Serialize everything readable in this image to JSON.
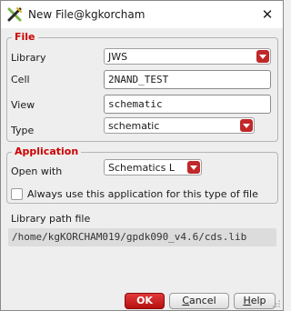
{
  "window": {
    "title": "New File@kgkorcham",
    "app_icon": "cadence-x-icon",
    "close_icon": "close-icon"
  },
  "file_group": {
    "legend": "File",
    "library_label": "Library",
    "library_value": "JWS",
    "cell_label": "Cell",
    "cell_value": "2NAND_TEST",
    "view_label": "View",
    "view_value": "schematic",
    "type_label": "Type",
    "type_value": "schematic"
  },
  "application_group": {
    "legend": "Application",
    "open_with_label": "Open with",
    "open_with_value": "Schematics L",
    "always_use_label": "Always use this application for this type of file",
    "always_use_checked": false
  },
  "library_path": {
    "label": "Library path file",
    "value": "/home/kgKORCHAM019/gpdk090_v4.6/cds.lib"
  },
  "buttons": {
    "ok": "OK",
    "cancel_first": "C",
    "cancel_rest": "ancel",
    "help_first": "H",
    "help_rest": "elp"
  },
  "colors": {
    "accent": "#cc0000",
    "ok_button": "#c41a1a"
  }
}
